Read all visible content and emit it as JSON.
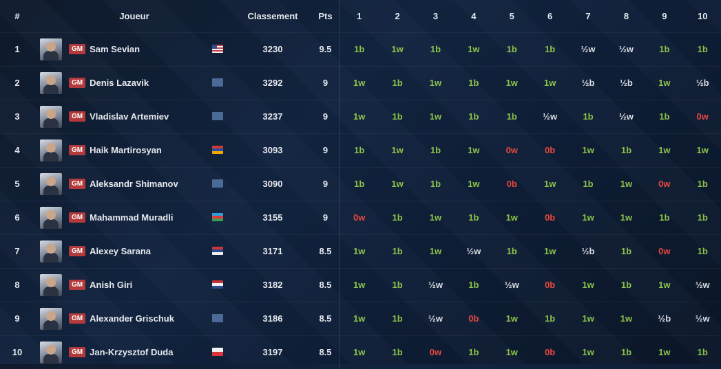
{
  "headers": {
    "rank": "#",
    "player": "Joueur",
    "rating": "Classement",
    "points": "Pts",
    "rounds": [
      "1",
      "2",
      "3",
      "4",
      "5",
      "6",
      "7",
      "8",
      "9",
      "10"
    ]
  },
  "colors": {
    "win": "#8bc34a",
    "loss": "#e5483d",
    "draw": "#d8dbe0",
    "title_badge": "#b33a3a"
  },
  "rows": [
    {
      "rank": "1",
      "title": "GM",
      "name": "Sam Sevian",
      "flag": "us",
      "rating": "3230",
      "pts": "9.5",
      "results": [
        "1b",
        "1w",
        "1b",
        "1w",
        "1b",
        "1b",
        "½w",
        "½w",
        "1b",
        "1b"
      ]
    },
    {
      "rank": "2",
      "title": "GM",
      "name": "Denis Lazavik",
      "flag": "gen",
      "rating": "3292",
      "pts": "9",
      "results": [
        "1w",
        "1b",
        "1w",
        "1b",
        "1w",
        "1w",
        "½b",
        "½b",
        "1w",
        "½b"
      ]
    },
    {
      "rank": "3",
      "title": "GM",
      "name": "Vladislav Artemiev",
      "flag": "gen",
      "rating": "3237",
      "pts": "9",
      "results": [
        "1w",
        "1b",
        "1w",
        "1b",
        "1b",
        "½w",
        "1b",
        "½w",
        "1b",
        "0w"
      ]
    },
    {
      "rank": "4",
      "title": "GM",
      "name": "Haik Martirosyan",
      "flag": "am",
      "rating": "3093",
      "pts": "9",
      "results": [
        "1b",
        "1w",
        "1b",
        "1w",
        "0w",
        "0b",
        "1w",
        "1b",
        "1w",
        "1w"
      ]
    },
    {
      "rank": "5",
      "title": "GM",
      "name": "Aleksandr Shimanov",
      "flag": "gen",
      "rating": "3090",
      "pts": "9",
      "results": [
        "1b",
        "1w",
        "1b",
        "1w",
        "0b",
        "1w",
        "1b",
        "1w",
        "0w",
        "1b"
      ]
    },
    {
      "rank": "6",
      "title": "GM",
      "name": "Mahammad Muradli",
      "flag": "az",
      "rating": "3155",
      "pts": "9",
      "results": [
        "0w",
        "1b",
        "1w",
        "1b",
        "1w",
        "0b",
        "1w",
        "1w",
        "1b",
        "1b"
      ]
    },
    {
      "rank": "7",
      "title": "GM",
      "name": "Alexey Sarana",
      "flag": "rs",
      "rating": "3171",
      "pts": "8.5",
      "results": [
        "1w",
        "1b",
        "1w",
        "½w",
        "1b",
        "1w",
        "½b",
        "1b",
        "0w",
        "1b"
      ]
    },
    {
      "rank": "8",
      "title": "GM",
      "name": "Anish Giri",
      "flag": "nl",
      "rating": "3182",
      "pts": "8.5",
      "results": [
        "1w",
        "1b",
        "½w",
        "1b",
        "½w",
        "0b",
        "1w",
        "1b",
        "1w",
        "½w"
      ]
    },
    {
      "rank": "9",
      "title": "GM",
      "name": "Alexander Grischuk",
      "flag": "gen",
      "rating": "3186",
      "pts": "8.5",
      "results": [
        "1w",
        "1b",
        "½w",
        "0b",
        "1w",
        "1b",
        "1w",
        "1w",
        "½b",
        "½w"
      ]
    },
    {
      "rank": "10",
      "title": "GM",
      "name": "Jan-Krzysztof Duda",
      "flag": "pl",
      "rating": "3197",
      "pts": "8.5",
      "results": [
        "1w",
        "1b",
        "0w",
        "1b",
        "1w",
        "0b",
        "1w",
        "1b",
        "1w",
        "1b"
      ]
    }
  ]
}
